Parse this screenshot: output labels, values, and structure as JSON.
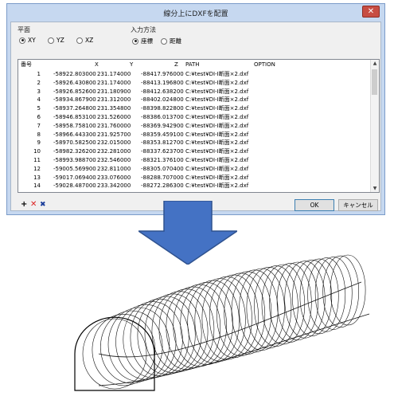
{
  "window": {
    "title": "線分上にDXFを配置",
    "close_glyph": "✕"
  },
  "plane": {
    "label": "平面",
    "options": [
      {
        "label": "XY",
        "selected": true
      },
      {
        "label": "YZ",
        "selected": false
      },
      {
        "label": "XZ",
        "selected": false
      }
    ]
  },
  "input_method": {
    "label": "入力方法",
    "options": [
      {
        "label": "座標",
        "selected": true
      },
      {
        "label": "距離",
        "selected": false
      }
    ]
  },
  "table": {
    "headers": [
      "番号",
      "X",
      "Y",
      "Z",
      "PATH",
      "OPTION"
    ],
    "rows": [
      [
        "1",
        "-58922.803000",
        "231.174000",
        "-88417.976000",
        "C:¥test¥DI-I断面×2.dxf",
        ""
      ],
      [
        "2",
        "-58926.430800",
        "231.174000",
        "-88413.196800",
        "C:¥test¥DI-I断面×2.dxf",
        ""
      ],
      [
        "3",
        "-58926.852600",
        "231.180900",
        "-88412.638200",
        "C:¥test¥DI-I断面×2.dxf",
        ""
      ],
      [
        "4",
        "-58934.867900",
        "231.312000",
        "-88402.024800",
        "C:¥test¥DI-I断面×2.dxf",
        ""
      ],
      [
        "5",
        "-58937.264800",
        "231.354800",
        "-88398.822800",
        "C:¥test¥DI-I断面×2.dxf",
        ""
      ],
      [
        "6",
        "-58946.853100",
        "231.526000",
        "-88386.013700",
        "C:¥test¥DI-I断面×2.dxf",
        ""
      ],
      [
        "7",
        "-58958.758100",
        "231.760000",
        "-88369.942900",
        "C:¥test¥DI-I断面×2.dxf",
        ""
      ],
      [
        "8",
        "-58966.443300",
        "231.925700",
        "-88359.459100",
        "C:¥test¥DI-I断面×2.dxf",
        ""
      ],
      [
        "9",
        "-58970.582500",
        "232.015000",
        "-88353.812700",
        "C:¥test¥DI-I断面×2.dxf",
        ""
      ],
      [
        "10",
        "-58982.326200",
        "232.281000",
        "-88337.623700",
        "C:¥test¥DI-I断面×2.dxf",
        ""
      ],
      [
        "11",
        "-58993.988700",
        "232.546000",
        "-88321.376100",
        "C:¥test¥DI-I断面×2.dxf",
        ""
      ],
      [
        "12",
        "-59005.569900",
        "232.811000",
        "-88305.070400",
        "C:¥test¥DI-I断面×2.dxf",
        ""
      ],
      [
        "13",
        "-59017.069400",
        "233.076000",
        "-88288.707000",
        "C:¥test¥DI-I断面×2.dxf",
        ""
      ],
      [
        "14",
        "-59028.487000",
        "233.342000",
        "-88272.286300",
        "C:¥test¥DI-I断面×2.dxf",
        ""
      ]
    ]
  },
  "toolbar": {
    "add_glyph": "+",
    "delete_glyph": "✕",
    "clear_glyph": "✖"
  },
  "buttons": {
    "ok": "OK",
    "cancel": "キャンセル"
  },
  "colors": {
    "title_bar": "#c6d8f0",
    "close_button": "#c74d43",
    "arrow_fill": "#4472c4",
    "arrow_stroke": "#2f528f"
  }
}
